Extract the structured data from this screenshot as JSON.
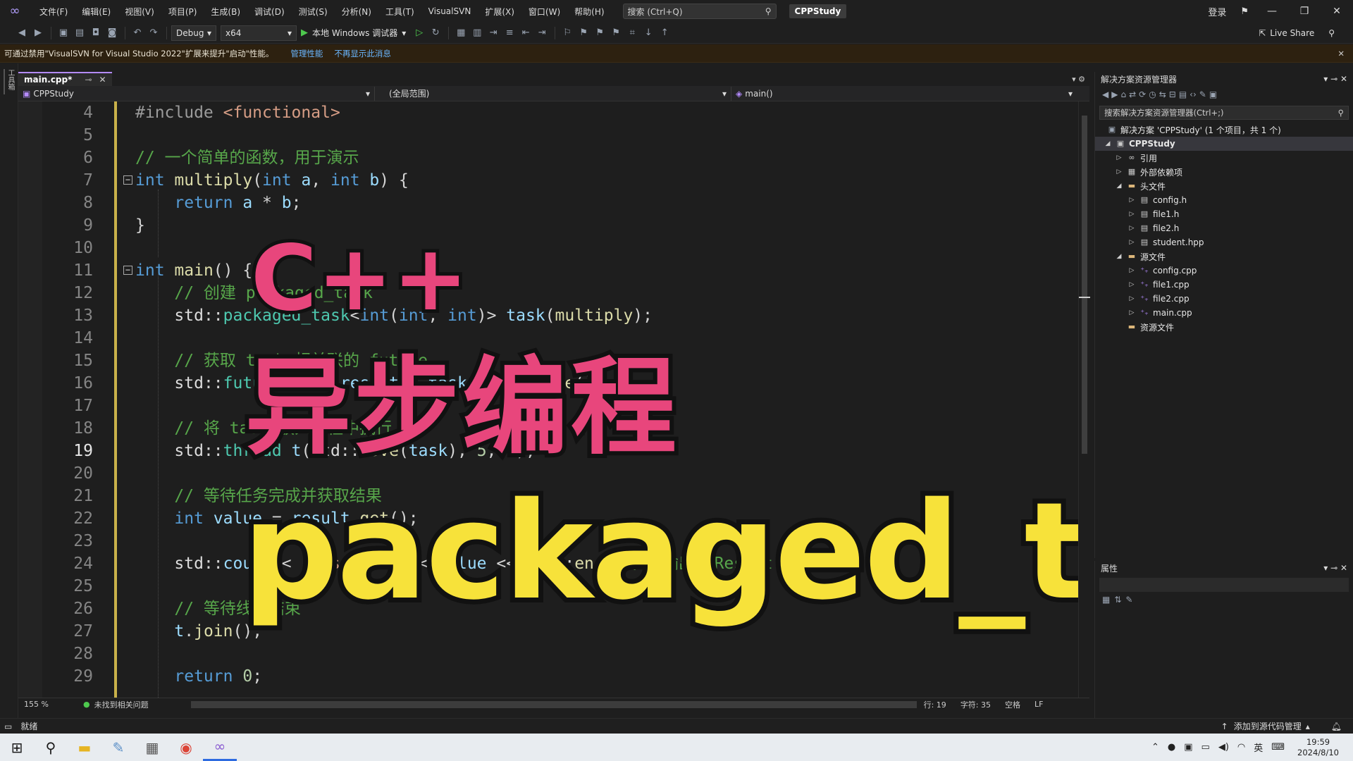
{
  "titlebar": {
    "menus": [
      "文件(F)",
      "编辑(E)",
      "视图(V)",
      "项目(P)",
      "生成(B)",
      "调试(D)",
      "测试(S)",
      "分析(N)",
      "工具(T)",
      "VisualSVN",
      "扩展(X)",
      "窗口(W)",
      "帮助(H)"
    ],
    "search_placeholder": "搜索 (Ctrl+Q)",
    "project_name": "CPPStudy",
    "login": "登录"
  },
  "toolbar": {
    "config": "Debug",
    "platform": "x64",
    "run_label": "本地 Windows 调试器",
    "live_share": "Live Share"
  },
  "infobar": {
    "message": "可通过禁用\"VisualSVN for Visual Studio 2022\"扩展来提升\"启动\"性能。",
    "link_manage": "管理性能",
    "link_dismiss": "不再显示此消息"
  },
  "left_strip": {
    "tab": "工具箱"
  },
  "editor": {
    "tab_name": "main.cpp*",
    "nav_project": "CPPStudy",
    "nav_scope": "(全局范围)",
    "nav_member": "main()",
    "lines": [
      {
        "n": "4",
        "text": "#include <functional>"
      },
      {
        "n": "5",
        "text": ""
      },
      {
        "n": "6",
        "text": "// 一个简单的函数，用于演示"
      },
      {
        "n": "7",
        "text": "int multiply(int a, int b) {"
      },
      {
        "n": "8",
        "text": "    return a * b;"
      },
      {
        "n": "9",
        "text": "}"
      },
      {
        "n": "10",
        "text": ""
      },
      {
        "n": "11",
        "text": "int main() {"
      },
      {
        "n": "12",
        "text": "    // 创建 packaged_task"
      },
      {
        "n": "13",
        "text": "    std::packaged_task<int(int, int)> task(multiply);"
      },
      {
        "n": "14",
        "text": ""
      },
      {
        "n": "15",
        "text": "    // 获取 task 相关联的 future"
      },
      {
        "n": "16",
        "text": "    std::future<int> result = task.get_future();"
      },
      {
        "n": "17",
        "text": ""
      },
      {
        "n": "18",
        "text": "    // 将 task 放入线程中执行"
      },
      {
        "n": "19",
        "text": "    std::thread t(std::move(task), 5, 6);"
      },
      {
        "n": "20",
        "text": ""
      },
      {
        "n": "21",
        "text": "    // 等待任务完成并获取结果"
      },
      {
        "n": "22",
        "text": "    int value = result.get();"
      },
      {
        "n": "23",
        "text": ""
      },
      {
        "n": "24",
        "text": "    std::cout << \"Result: \" << value << std::endl; // 输出 \"Result: 30\""
      },
      {
        "n": "25",
        "text": ""
      },
      {
        "n": "26",
        "text": "    // 等待线程结束"
      },
      {
        "n": "27",
        "text": "    t.join();"
      },
      {
        "n": "28",
        "text": ""
      },
      {
        "n": "29",
        "text": "    return 0;"
      }
    ],
    "current_line": "19",
    "zoom": "155 %",
    "issues": "未找到相关问题",
    "cursor_line": "行: 19",
    "cursor_col": "字符: 35",
    "whitespace": "空格",
    "eol": "LF"
  },
  "solution_explorer": {
    "title": "解决方案资源管理器",
    "search_placeholder": "搜索解决方案资源管理器(Ctrl+;)",
    "items": [
      {
        "label": "解决方案 'CPPStudy' (1 个项目，共 1 个)",
        "icon": "solution-icon"
      },
      {
        "label": "CPPStudy",
        "icon": "project-icon"
      },
      {
        "label": "引用",
        "icon": "references-icon"
      },
      {
        "label": "外部依赖项",
        "icon": "external-deps-icon"
      },
      {
        "label": "头文件",
        "icon": "folder-icon"
      },
      {
        "label": "config.h",
        "icon": "header-file-icon"
      },
      {
        "label": "file1.h",
        "icon": "header-file-icon"
      },
      {
        "label": "file2.h",
        "icon": "header-file-icon"
      },
      {
        "label": "student.hpp",
        "icon": "header-file-icon"
      },
      {
        "label": "源文件",
        "icon": "folder-icon"
      },
      {
        "label": "config.cpp",
        "icon": "cpp-file-icon"
      },
      {
        "label": "file1.cpp",
        "icon": "cpp-file-icon"
      },
      {
        "label": "file2.cpp",
        "icon": "cpp-file-icon"
      },
      {
        "label": "main.cpp",
        "icon": "cpp-file-icon"
      },
      {
        "label": "资源文件",
        "icon": "folder-icon"
      }
    ]
  },
  "properties": {
    "title": "属性"
  },
  "statusbar": {
    "ready": "就绪",
    "source_control": "添加到源代码管理"
  },
  "taskbar": {
    "ime": "英",
    "time": "19:59",
    "date": "2024/8/10"
  },
  "overlay": {
    "line1": "C++",
    "line2": "异步编程",
    "line3": "packaged_task"
  },
  "colors": {
    "accent": "#b48bff",
    "overlay_pink": "#e8467c",
    "overlay_yellow": "#f7e23a",
    "keyword": "#569cd6",
    "comment": "#57a64a",
    "type": "#4ec9b0",
    "string": "#d69d85"
  }
}
